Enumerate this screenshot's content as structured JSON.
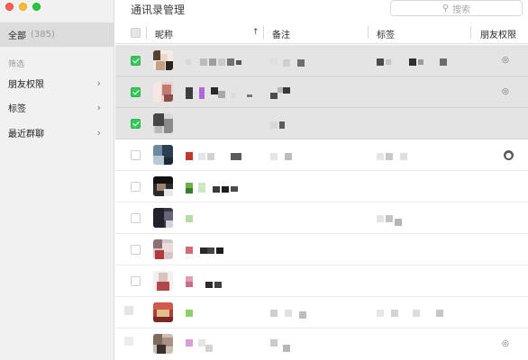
{
  "window": {
    "title": "通讯录管理",
    "controls": [
      "close",
      "minimize",
      "zoom"
    ]
  },
  "search": {
    "placeholder": "搜索",
    "icon": "search-icon"
  },
  "sidebar": {
    "all_label": "全部",
    "all_count": "(385)",
    "filter_label": "筛选",
    "items": [
      {
        "label": "朋友权限",
        "icon": "chevron-right-icon"
      },
      {
        "label": "标签",
        "icon": "chevron-right-icon"
      },
      {
        "label": "最近群聊",
        "icon": "chevron-right-icon"
      }
    ]
  },
  "table": {
    "columns": [
      "昵称",
      "备注",
      "标签",
      "朋友权限"
    ],
    "sort_indicator": "↑",
    "rows": [
      {
        "selected": true,
        "permission_icon": "hidden-eye-icon"
      },
      {
        "selected": true,
        "permission_icon": "hidden-eye-icon"
      },
      {
        "selected": true,
        "permission_icon": ""
      },
      {
        "selected": false,
        "permission_icon": "user-badge-icon"
      },
      {
        "selected": false,
        "permission_icon": ""
      },
      {
        "selected": false,
        "permission_icon": ""
      },
      {
        "selected": false,
        "permission_icon": ""
      },
      {
        "selected": false,
        "permission_icon": ""
      },
      {
        "selected": false,
        "permission_icon": ""
      },
      {
        "selected": false,
        "permission_icon": "hidden-eye-icon"
      }
    ]
  },
  "colors": {
    "accent_green": "#34c759",
    "selected_row": "#e4e4e4",
    "sidebar_bg": "#f1f1f1"
  }
}
